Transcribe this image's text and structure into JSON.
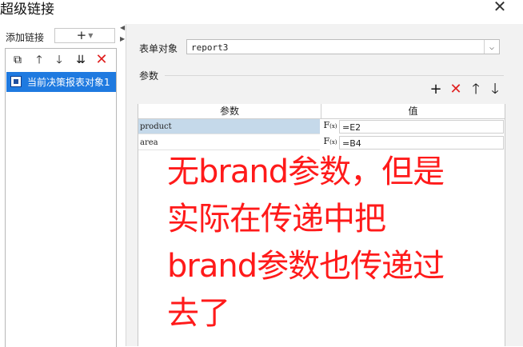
{
  "window": {
    "title": "超级链接"
  },
  "left": {
    "add_label": "添加链接",
    "add_button": "+",
    "toolbar": [
      "copy-icon",
      "arrow-up-icon",
      "arrow-down-icon",
      "move-to-bottom-icon",
      "delete-icon"
    ],
    "items": [
      {
        "label": "当前决策报表对象1"
      }
    ]
  },
  "right": {
    "form_label": "表单对象",
    "form_value": "report3",
    "params_label": "参数",
    "param_toolbar": [
      "add-icon",
      "delete-icon",
      "arrow-up-icon",
      "arrow-down-icon"
    ],
    "table": {
      "headers": [
        "参数",
        "值"
      ],
      "rows": [
        {
          "name": "product",
          "fx": "F",
          "value": "=E2"
        },
        {
          "name": "area",
          "fx": "F",
          "value": "=B4"
        }
      ]
    }
  },
  "annotation": {
    "lines": [
      "无brand参数，但是",
      "实际在传递中把",
      "brand参数也传递过",
      "去了"
    ],
    "color": "#ff1a1a"
  },
  "colors": {
    "selection": "#1f7ae0",
    "row_selected": "#c5d9ea",
    "delete_red": "#e02020"
  }
}
